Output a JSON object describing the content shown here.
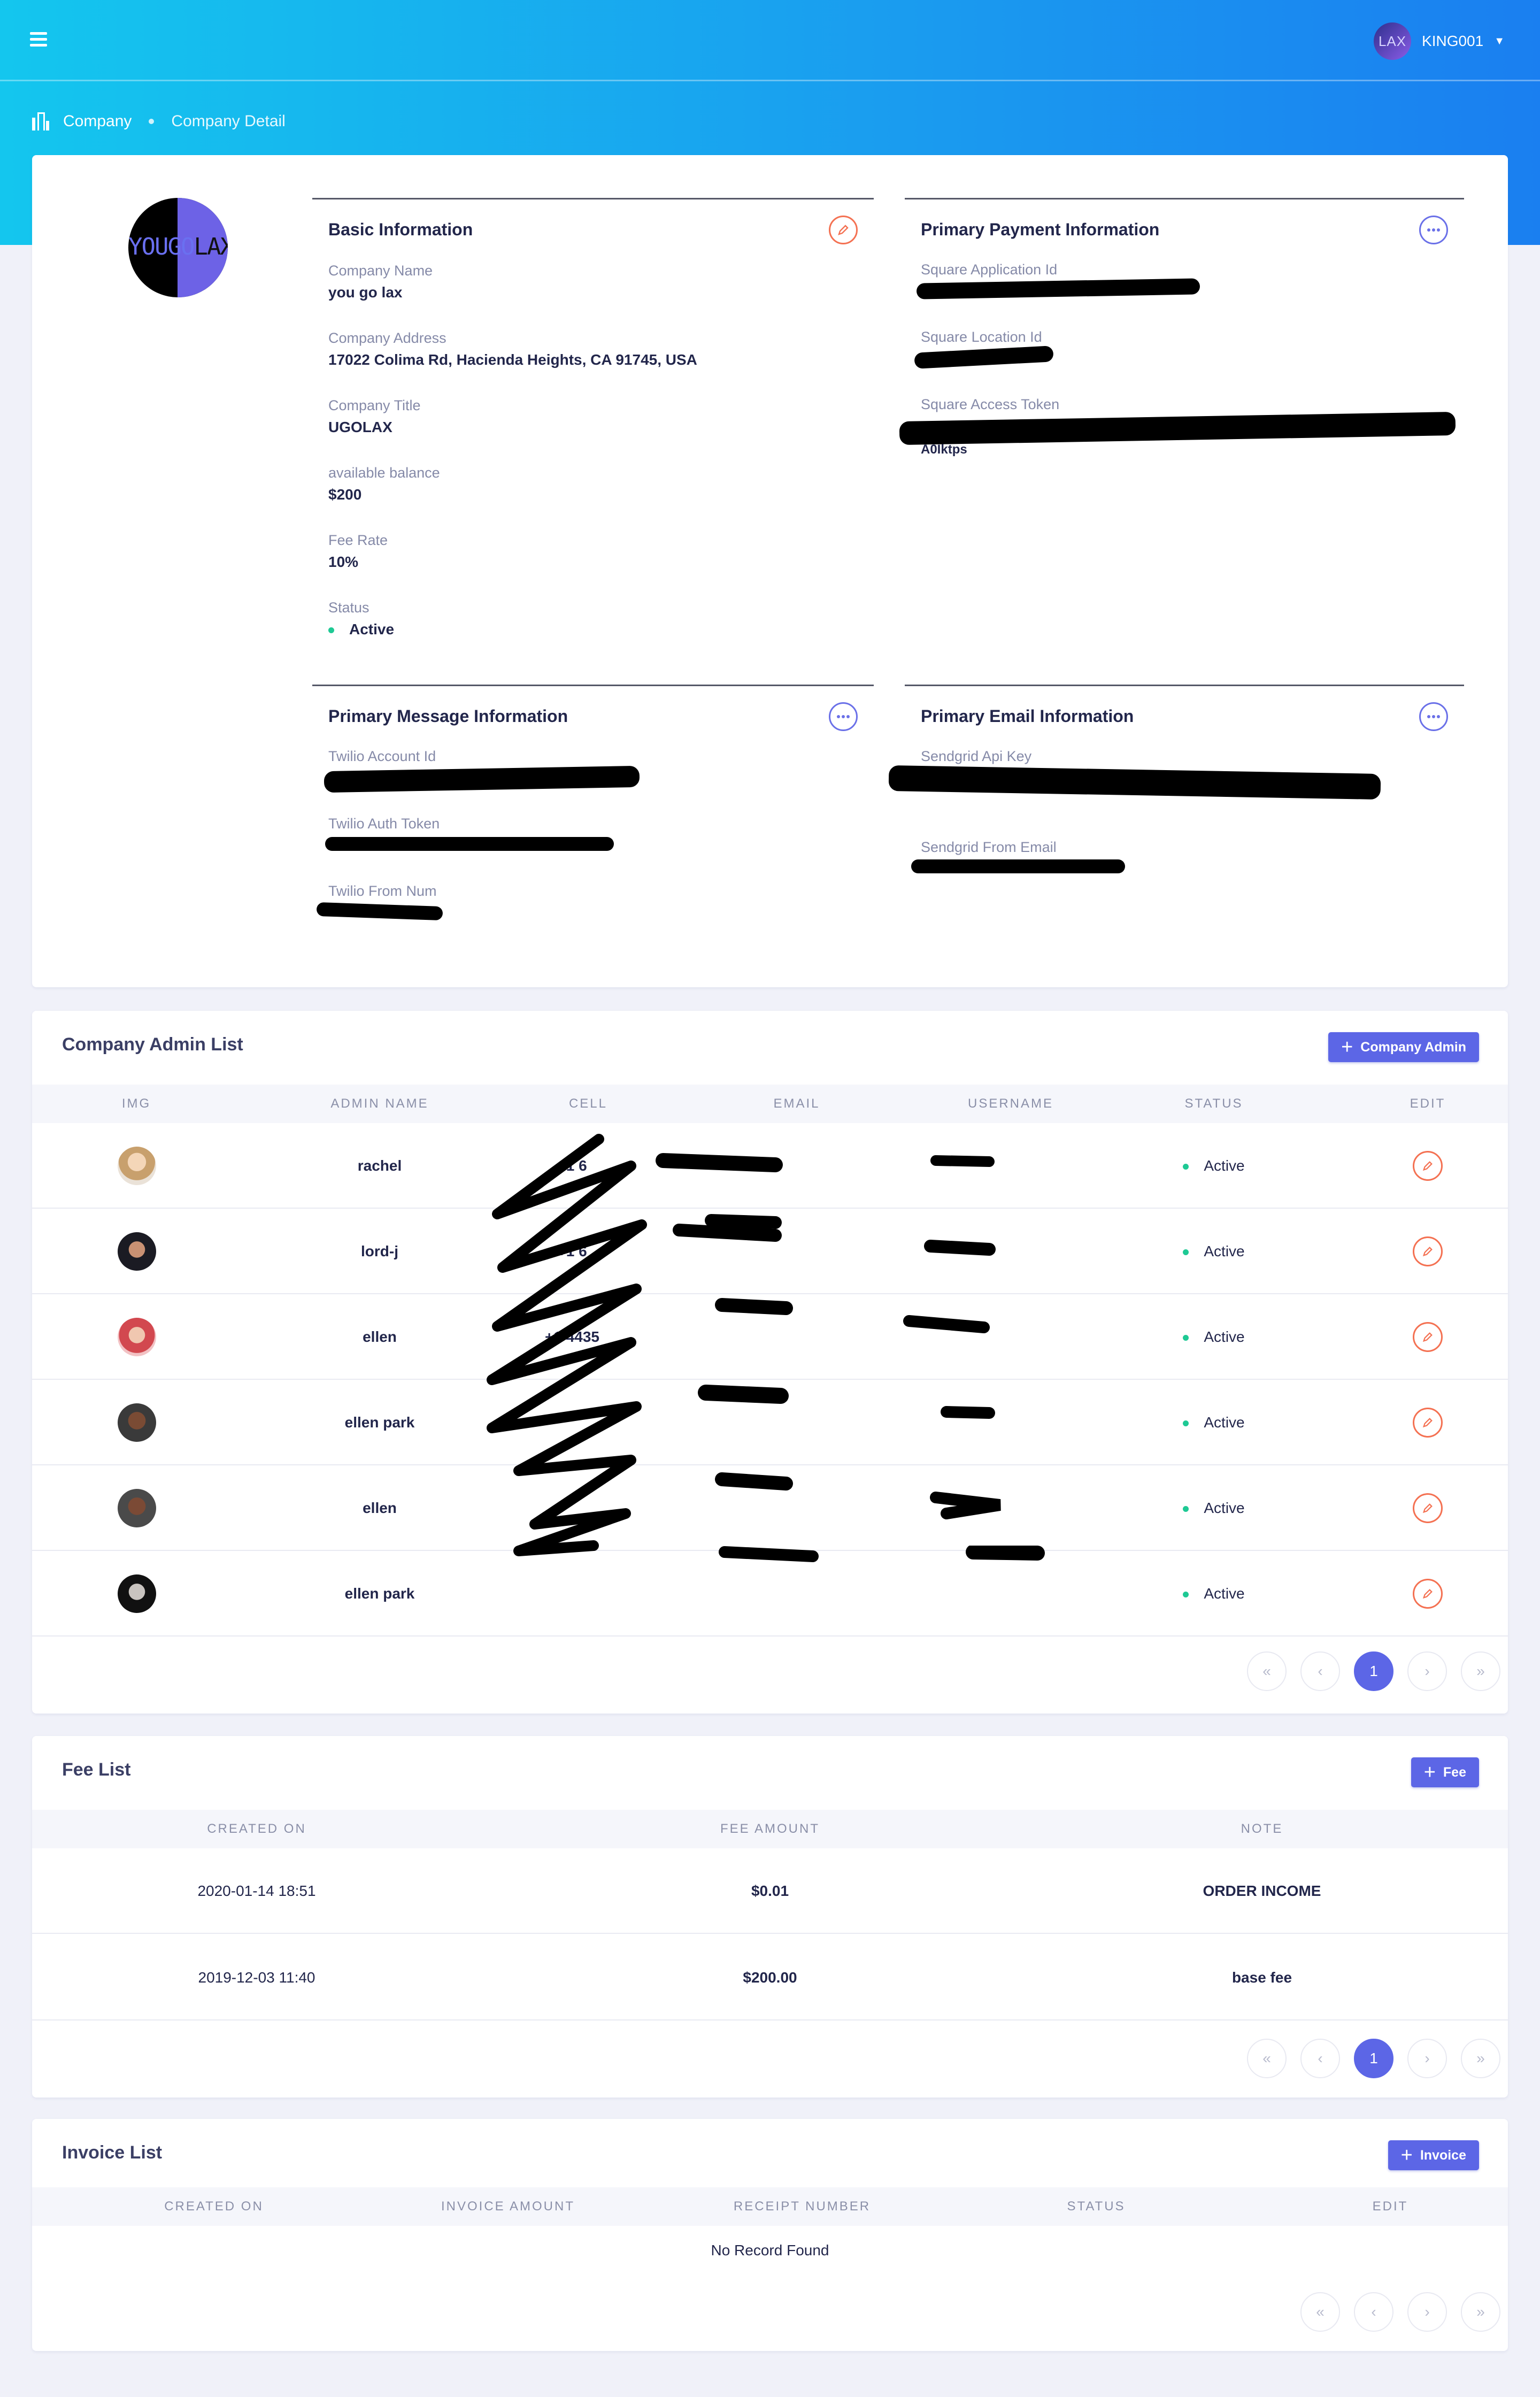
{
  "topbar": {
    "user_avatar_text": "LAX",
    "user_name": "KING001"
  },
  "breadcrumb": {
    "root": "Company",
    "current": "Company Detail"
  },
  "company": {
    "logo_text_left": "YOUGO",
    "logo_text_right": "LAX",
    "basic": {
      "title": "Basic Information",
      "name_label": "Company Name",
      "name_value": "you go lax",
      "address_label": "Company Address",
      "address_value": "17022 Colima Rd, Hacienda Heights, CA 91745, USA",
      "company_title_label": "Company Title",
      "company_title_value": "UGOLAX",
      "balance_label": "available balance",
      "balance_value": "$200",
      "fee_rate_label": "Fee Rate",
      "fee_rate_value": "10%",
      "status_label": "Status",
      "status_value": "Active"
    },
    "payment": {
      "title": "Primary Payment Information",
      "app_id_label": "Square Application Id",
      "location_id_label": "Square Location Id",
      "access_token_label": "Square Access Token",
      "access_token_tail": "A0Iktps"
    },
    "message": {
      "title": "Primary Message Information",
      "account_id_label": "Twilio Account Id",
      "auth_token_label": "Twilio Auth Token",
      "from_num_label": "Twilio From Num"
    },
    "email": {
      "title": "Primary Email Information",
      "api_key_label": "Sendgrid Api Key",
      "from_email_label": "Sendgrid From Email"
    }
  },
  "admins": {
    "title": "Company Admin List",
    "add_label": "Company Admin",
    "columns": [
      "IMG",
      "ADMIN NAME",
      "CELL",
      "EMAIL",
      "USERNAME",
      "STATUS",
      "EDIT"
    ],
    "rows": [
      {
        "name": "rachel",
        "cell": "+1 6",
        "status": "Active"
      },
      {
        "name": "lord-j",
        "cell": "+1 6",
        "status": "Active"
      },
      {
        "name": "ellen",
        "cell": "+1 4435",
        "status": "Active"
      },
      {
        "name": "ellen park",
        "cell": "",
        "status": "Active"
      },
      {
        "name": "ellen",
        "cell": "",
        "status": "Active"
      },
      {
        "name": "ellen park",
        "cell": "",
        "status": "Active"
      }
    ],
    "pager": {
      "first": "«",
      "prev": "‹",
      "page": "1",
      "next": "›",
      "last": "»"
    }
  },
  "fees": {
    "title": "Fee List",
    "add_label": "Fee",
    "columns": [
      "CREATED ON",
      "FEE AMOUNT",
      "NOTE"
    ],
    "rows": [
      {
        "created": "2020-01-14 18:51",
        "amount": "$0.01",
        "note": "ORDER INCOME"
      },
      {
        "created": "2019-12-03 11:40",
        "amount": "$200.00",
        "note": "base fee"
      }
    ],
    "pager": {
      "first": "«",
      "prev": "‹",
      "page": "1",
      "next": "›",
      "last": "»"
    }
  },
  "invoices": {
    "title": "Invoice List",
    "add_label": "Invoice",
    "columns": [
      "CREATED ON",
      "INVOICE AMOUNT",
      "RECEIPT NUMBER",
      "STATUS",
      "EDIT"
    ],
    "empty_text": "No Record Found",
    "pager": {
      "first": "«",
      "prev": "‹",
      "next": "›",
      "last": "»"
    }
  },
  "colors": {
    "accent": "#5c66e6",
    "status_active": "#1ec994",
    "edit": "#f47152",
    "header_start": "#14c6ee",
    "header_end": "#1a7ff0"
  }
}
